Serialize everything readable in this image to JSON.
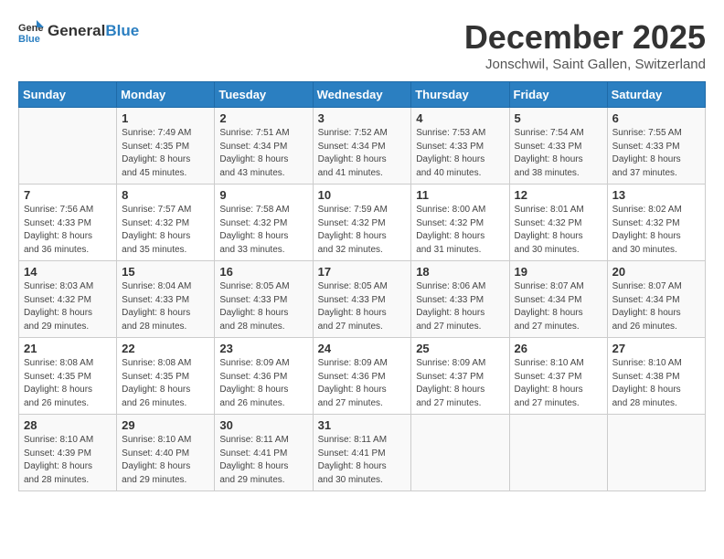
{
  "logo": {
    "general": "General",
    "blue": "Blue"
  },
  "title": "December 2025",
  "subtitle": "Jonschwil, Saint Gallen, Switzerland",
  "headers": [
    "Sunday",
    "Monday",
    "Tuesday",
    "Wednesday",
    "Thursday",
    "Friday",
    "Saturday"
  ],
  "weeks": [
    [
      {
        "day": "",
        "info": ""
      },
      {
        "day": "1",
        "info": "Sunrise: 7:49 AM\nSunset: 4:35 PM\nDaylight: 8 hours\nand 45 minutes."
      },
      {
        "day": "2",
        "info": "Sunrise: 7:51 AM\nSunset: 4:34 PM\nDaylight: 8 hours\nand 43 minutes."
      },
      {
        "day": "3",
        "info": "Sunrise: 7:52 AM\nSunset: 4:34 PM\nDaylight: 8 hours\nand 41 minutes."
      },
      {
        "day": "4",
        "info": "Sunrise: 7:53 AM\nSunset: 4:33 PM\nDaylight: 8 hours\nand 40 minutes."
      },
      {
        "day": "5",
        "info": "Sunrise: 7:54 AM\nSunset: 4:33 PM\nDaylight: 8 hours\nand 38 minutes."
      },
      {
        "day": "6",
        "info": "Sunrise: 7:55 AM\nSunset: 4:33 PM\nDaylight: 8 hours\nand 37 minutes."
      }
    ],
    [
      {
        "day": "7",
        "info": "Sunrise: 7:56 AM\nSunset: 4:33 PM\nDaylight: 8 hours\nand 36 minutes."
      },
      {
        "day": "8",
        "info": "Sunrise: 7:57 AM\nSunset: 4:32 PM\nDaylight: 8 hours\nand 35 minutes."
      },
      {
        "day": "9",
        "info": "Sunrise: 7:58 AM\nSunset: 4:32 PM\nDaylight: 8 hours\nand 33 minutes."
      },
      {
        "day": "10",
        "info": "Sunrise: 7:59 AM\nSunset: 4:32 PM\nDaylight: 8 hours\nand 32 minutes."
      },
      {
        "day": "11",
        "info": "Sunrise: 8:00 AM\nSunset: 4:32 PM\nDaylight: 8 hours\nand 31 minutes."
      },
      {
        "day": "12",
        "info": "Sunrise: 8:01 AM\nSunset: 4:32 PM\nDaylight: 8 hours\nand 30 minutes."
      },
      {
        "day": "13",
        "info": "Sunrise: 8:02 AM\nSunset: 4:32 PM\nDaylight: 8 hours\nand 30 minutes."
      }
    ],
    [
      {
        "day": "14",
        "info": "Sunrise: 8:03 AM\nSunset: 4:32 PM\nDaylight: 8 hours\nand 29 minutes."
      },
      {
        "day": "15",
        "info": "Sunrise: 8:04 AM\nSunset: 4:33 PM\nDaylight: 8 hours\nand 28 minutes."
      },
      {
        "day": "16",
        "info": "Sunrise: 8:05 AM\nSunset: 4:33 PM\nDaylight: 8 hours\nand 28 minutes."
      },
      {
        "day": "17",
        "info": "Sunrise: 8:05 AM\nSunset: 4:33 PM\nDaylight: 8 hours\nand 27 minutes."
      },
      {
        "day": "18",
        "info": "Sunrise: 8:06 AM\nSunset: 4:33 PM\nDaylight: 8 hours\nand 27 minutes."
      },
      {
        "day": "19",
        "info": "Sunrise: 8:07 AM\nSunset: 4:34 PM\nDaylight: 8 hours\nand 27 minutes."
      },
      {
        "day": "20",
        "info": "Sunrise: 8:07 AM\nSunset: 4:34 PM\nDaylight: 8 hours\nand 26 minutes."
      }
    ],
    [
      {
        "day": "21",
        "info": "Sunrise: 8:08 AM\nSunset: 4:35 PM\nDaylight: 8 hours\nand 26 minutes."
      },
      {
        "day": "22",
        "info": "Sunrise: 8:08 AM\nSunset: 4:35 PM\nDaylight: 8 hours\nand 26 minutes."
      },
      {
        "day": "23",
        "info": "Sunrise: 8:09 AM\nSunset: 4:36 PM\nDaylight: 8 hours\nand 26 minutes."
      },
      {
        "day": "24",
        "info": "Sunrise: 8:09 AM\nSunset: 4:36 PM\nDaylight: 8 hours\nand 27 minutes."
      },
      {
        "day": "25",
        "info": "Sunrise: 8:09 AM\nSunset: 4:37 PM\nDaylight: 8 hours\nand 27 minutes."
      },
      {
        "day": "26",
        "info": "Sunrise: 8:10 AM\nSunset: 4:37 PM\nDaylight: 8 hours\nand 27 minutes."
      },
      {
        "day": "27",
        "info": "Sunrise: 8:10 AM\nSunset: 4:38 PM\nDaylight: 8 hours\nand 28 minutes."
      }
    ],
    [
      {
        "day": "28",
        "info": "Sunrise: 8:10 AM\nSunset: 4:39 PM\nDaylight: 8 hours\nand 28 minutes."
      },
      {
        "day": "29",
        "info": "Sunrise: 8:10 AM\nSunset: 4:40 PM\nDaylight: 8 hours\nand 29 minutes."
      },
      {
        "day": "30",
        "info": "Sunrise: 8:11 AM\nSunset: 4:41 PM\nDaylight: 8 hours\nand 29 minutes."
      },
      {
        "day": "31",
        "info": "Sunrise: 8:11 AM\nSunset: 4:41 PM\nDaylight: 8 hours\nand 30 minutes."
      },
      {
        "day": "",
        "info": ""
      },
      {
        "day": "",
        "info": ""
      },
      {
        "day": "",
        "info": ""
      }
    ]
  ]
}
